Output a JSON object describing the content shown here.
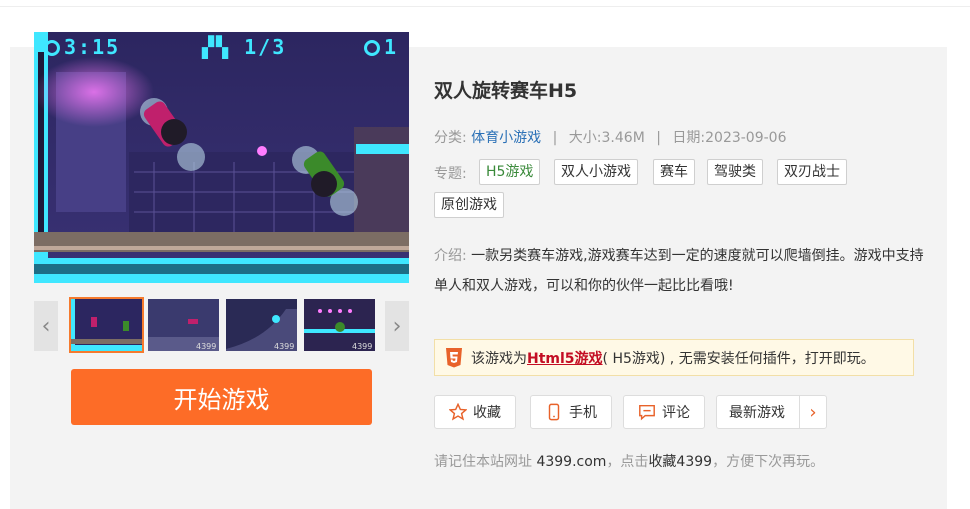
{
  "game": {
    "title": "双人旋转赛车H5",
    "category_label": "分类:",
    "category": "体育小游戏",
    "separator": "|",
    "size_label": "大小:",
    "size": "3.46M",
    "date_label": "日期:",
    "date": "2023-09-06",
    "topics_label": "专题:",
    "topics": [
      "H5游戏",
      "双人小游戏",
      "赛车",
      "驾驶类",
      "双刃战士",
      "原创游戏"
    ],
    "intro_label": "介绍:",
    "intro_text": "一款另类赛车游戏,游戏赛车达到一定的速度就可以爬墙倒挂。游戏中支持单人和双人游戏，可以和你的伙伴一起比比看哦!"
  },
  "screenshot_hud": {
    "time": "3:15",
    "lap": "1/3",
    "position": "1"
  },
  "thumbnails": {
    "watermark": "4399",
    "count": 4,
    "selected_index": 0
  },
  "start_button": "开始游戏",
  "h5_notice": {
    "prefix": "该游戏为",
    "highlight": "Html5游戏",
    "suffix": "( H5游戏) , 无需安装任何插件，打开即玩。"
  },
  "actions": {
    "favorite": "收藏",
    "mobile": "手机",
    "comment": "评论",
    "latest": "最新游戏"
  },
  "tip": {
    "prefix": "请记住本站网址 ",
    "site": "4399.com",
    "middle": "，点击",
    "fav": "收藏4399",
    "suffix": "，方便下次再玩。"
  },
  "colors": {
    "accent": "#fd6c27",
    "link": "#2a70b6",
    "h5_red": "#c30d23",
    "hud_cyan": "#3fe7ff"
  }
}
